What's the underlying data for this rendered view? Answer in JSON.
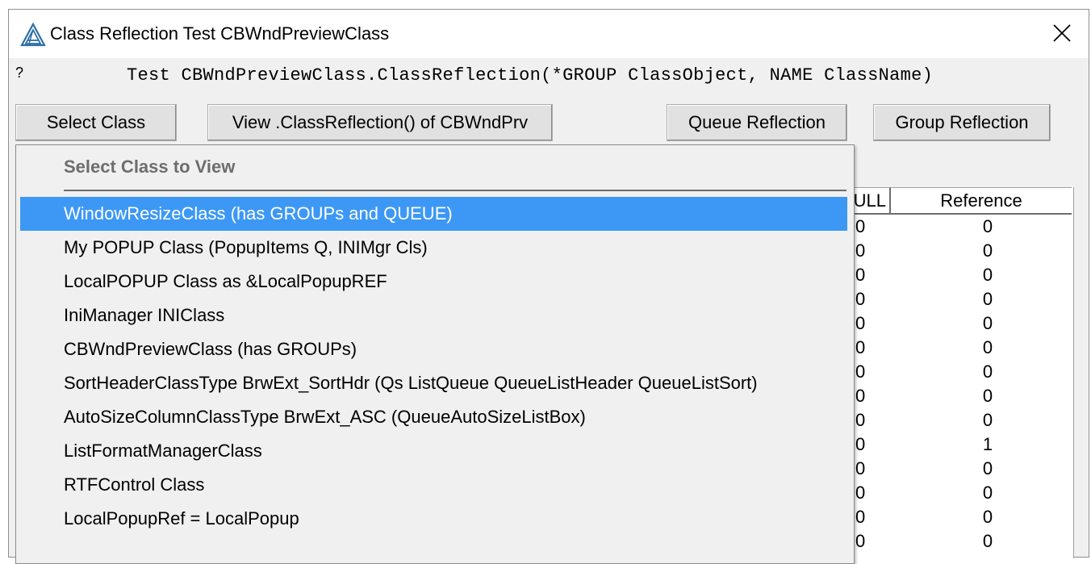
{
  "window": {
    "title": "Class Reflection Test CBWndPreviewClass"
  },
  "help_mark": "?",
  "test_prompt": "Test CBWndPreviewClass.ClassReflection(*GROUP ClassObject, NAME ClassName)",
  "toolbar": {
    "select_class": "Select Class",
    "view_reflection": "View .ClassReflection() of CBWndPrv",
    "queue_reflection": "Queue Reflection",
    "group_reflection": "Group Reflection"
  },
  "grid": {
    "headers": {
      "null": "ULL",
      "reference": "Reference"
    },
    "rows": [
      {
        "null": "0",
        "reference": "0"
      },
      {
        "null": "0",
        "reference": "0"
      },
      {
        "null": "0",
        "reference": "0"
      },
      {
        "null": "0",
        "reference": "0"
      },
      {
        "null": "0",
        "reference": "0"
      },
      {
        "null": "0",
        "reference": "0"
      },
      {
        "null": "0",
        "reference": "0"
      },
      {
        "null": "0",
        "reference": "0"
      },
      {
        "null": "0",
        "reference": "0"
      },
      {
        "null": "0",
        "reference": "1"
      },
      {
        "null": "0",
        "reference": "0"
      },
      {
        "null": "0",
        "reference": "0"
      },
      {
        "null": "0",
        "reference": "0"
      },
      {
        "null": "0",
        "reference": "0"
      }
    ]
  },
  "popup": {
    "title": "Select Class to View",
    "items": [
      {
        "label": "WindowResizeClass (has GROUPs and QUEUE)",
        "selected": true
      },
      {
        "label": "My POPUP Class (PopupItems Q, INIMgr Cls)",
        "selected": false
      },
      {
        "label": "LocalPOPUP Class as &LocalPopupREF",
        "selected": false
      },
      {
        "label": "IniManager  INIClass",
        "selected": false
      },
      {
        "label": "CBWndPreviewClass (has GROUPs)",
        "selected": false
      },
      {
        "label": "SortHeaderClassType BrwExt_SortHdr (Qs ListQueue QueueListHeader QueueListSort)",
        "selected": false
      },
      {
        "label": "AutoSizeColumnClassType BrwExt_ASC (QueueAutoSizeListBox)",
        "selected": false
      },
      {
        "label": "ListFormatManagerClass",
        "selected": false
      },
      {
        "label": "RTFControl Class",
        "selected": false
      },
      {
        "label": "LocalPopupRef = LocalPopup",
        "selected": false
      }
    ]
  },
  "colors": {
    "selection": "#3d98f5",
    "dialog_bg": "#f0f0f0",
    "button_bg": "#e1e1e1",
    "popup_title": "#6d6d6d"
  },
  "icons": {
    "app": "app-logo-icon",
    "close": "close-icon"
  }
}
